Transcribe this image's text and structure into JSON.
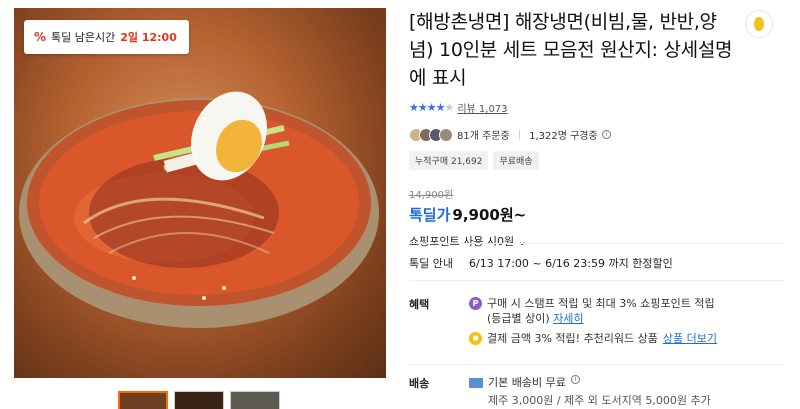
{
  "badge": {
    "icon": "percent-tag-icon",
    "label": "톡딜 남은시간",
    "time": "2일 12:00"
  },
  "product": {
    "title": "[해방촌냉면] 해장냉면(비빔,물, 반반,양념) 10인분 세트 모음전 원산지: 상세설명에 표시",
    "rating_stars": 4.5,
    "review_label": "리뷰 1,073",
    "order_count": "81개 주문중",
    "viewer_count": "1,322명 구경중",
    "tags": [
      "누적구매 21,692",
      "무료배송"
    ],
    "original_price": "14,900원",
    "deal_label": "톡딜가",
    "deal_price": "9,900원~",
    "points": "쇼핑포인트 사용 시0원 ⌄"
  },
  "deal_info": {
    "label": "톡딜 안내",
    "period": "6/13 17:00 ~ 6/16 23:59 까지 한정할인"
  },
  "benefits": {
    "label": "혜택",
    "line1": "구매 시 스탬프 적립 및 최대 3% 쇼핑포인트 적립",
    "line1_sub": "(등급별 상이)",
    "line1_link": "자세히",
    "line2": "결제 금액 3% 적립! 추천리워드 상품",
    "line2_link": "상품 더보기"
  },
  "shipping": {
    "label": "배송",
    "line1": "기본 배송비 무료",
    "line2": "제주 3,000원 / 제주 외 도서지역 5,000원 추가"
  },
  "colors": {
    "accent_red": "#e8341c",
    "accent_blue": "#1e6cd6"
  }
}
